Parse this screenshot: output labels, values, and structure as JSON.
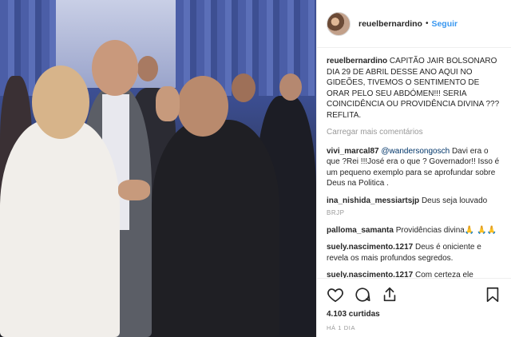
{
  "photo": {
    "alt_icon": "photo"
  },
  "header": {
    "username": "reuelbernardino",
    "dot": "•",
    "follow": "Seguir"
  },
  "caption": {
    "username": "reuelbernardino",
    "text": "CAPITÃO JAIR BOLSONARO DIA 29 DE ABRIL DESSE ANO AQUI NO GIDEÕES, TIVEMOS O SENTIMENTO DE ORAR PELO SEU ABDÓMEN!!! SERIA COINCIDÊNCIA OU PROVIDÊNCIA DIVINA ??? REFLITA."
  },
  "load_more": "Carregar mais comentários",
  "comments": [
    {
      "username": "vivi_marcal87",
      "mention": "@wandersongosch",
      "text": " Davi era o que ?Rei !!!José era o que ? Governador!! Isso é um pequeno exemplo para se aprofundar sobre Deus na Politica .",
      "reply": ""
    },
    {
      "username": "ina_nishida_messiartsjp",
      "mention": "",
      "text": " Deus seja louvado",
      "reply": "BRJP"
    },
    {
      "username": "palloma_samanta",
      "mention": "",
      "text": " Providências divina🙏 🙏🙏",
      "reply": ""
    },
    {
      "username": "suely.nascimento.1217",
      "mention": "",
      "text": " Deus é oniciente e revela os mais profundos segredos.",
      "reply": ""
    },
    {
      "username": "suely.nascimento.1217",
      "mention": "",
      "text": " Com certeza ele",
      "reply": ""
    }
  ],
  "actions": {
    "like": "heart-icon",
    "comment": "comment-icon",
    "share": "share-icon",
    "save": "bookmark-icon"
  },
  "likes": "4.103 curtidas",
  "date": "HÁ 1 DIA"
}
